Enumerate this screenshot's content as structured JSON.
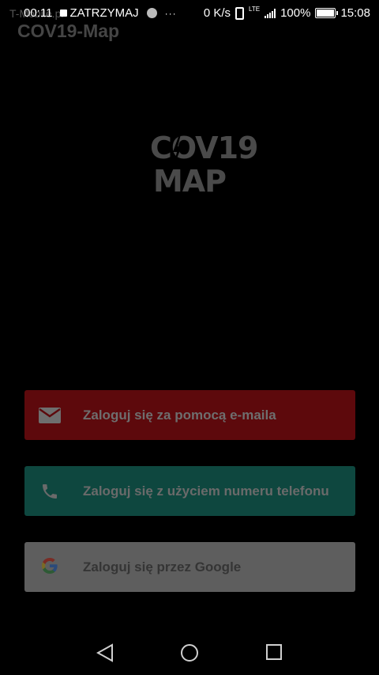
{
  "status_bar": {
    "underlay_text": "T-Mobile.pl",
    "timer": "00:11",
    "stop_label": "ZATRZYMAJ",
    "more": "···",
    "data_speed": "0 K/s",
    "network_type": "LTE",
    "battery": "100%",
    "clock": "15:08"
  },
  "app": {
    "title": "COV19-Map"
  },
  "logo": {
    "line1": "COV19",
    "line2": "MAP"
  },
  "login": {
    "email_label": "Zaloguj się za pomocą e-maila",
    "phone_label": "Zaloguj się z użyciem numeru telefonu",
    "google_label": "Zaloguj się przez Google"
  },
  "colors": {
    "email_button": "#5d090c",
    "phone_button": "#0e473f",
    "google_button": "#5e5e5e"
  },
  "icons": {
    "email": "envelope-icon",
    "phone": "phone-icon",
    "google": "google-g-icon",
    "nav_back": "back-triangle-icon",
    "nav_home": "home-circle-icon",
    "nav_recents": "recents-square-icon"
  }
}
